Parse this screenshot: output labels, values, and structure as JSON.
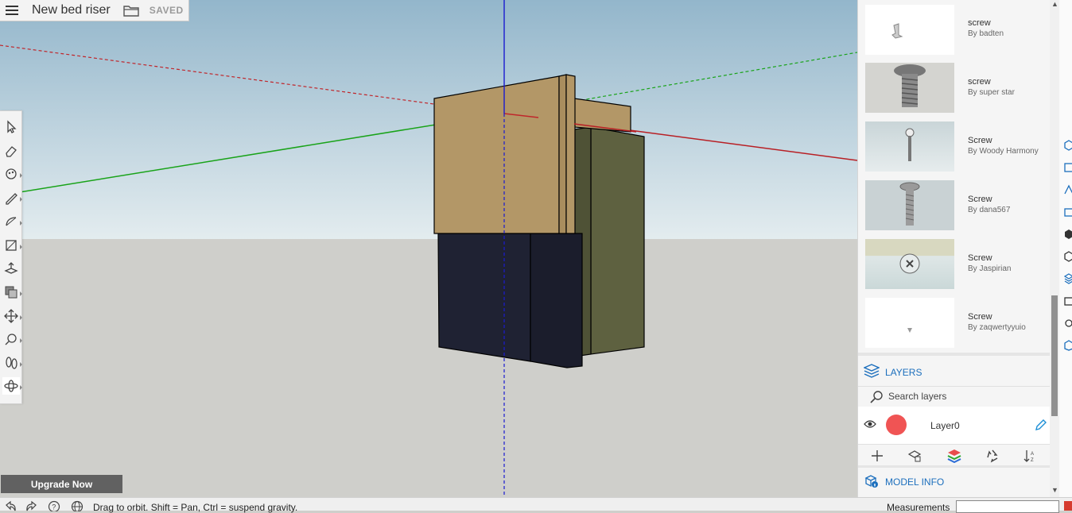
{
  "header": {
    "model_title": "New bed riser",
    "save_status": "SAVED"
  },
  "toolbar": {
    "tools": [
      {
        "name": "select-tool-icon"
      },
      {
        "name": "eraser-tool-icon"
      },
      {
        "name": "paint-bucket-tool-icon"
      },
      {
        "name": "pencil-line-tool-icon"
      },
      {
        "name": "arc-tool-icon"
      },
      {
        "name": "rectangle-tool-icon"
      },
      {
        "name": "push-pull-tool-icon"
      },
      {
        "name": "offset-tool-icon"
      },
      {
        "name": "move-tool-icon"
      },
      {
        "name": "tape-measure-tool-icon"
      },
      {
        "name": "walk-tool-icon"
      },
      {
        "name": "orbit-tool-icon"
      }
    ]
  },
  "upgrade": {
    "label": "Upgrade Now"
  },
  "statusbar": {
    "hint": "Drag to orbit. Shift = Pan, Ctrl = suspend gravity.",
    "measurements_label": "Measurements",
    "measurements_value": ""
  },
  "components": {
    "items": [
      {
        "name": "screw",
        "author": "By badten"
      },
      {
        "name": "screw",
        "author": "By super star"
      },
      {
        "name": "Screw",
        "author": "By Woody Harmony"
      },
      {
        "name": "Screw",
        "author": "By dana567"
      },
      {
        "name": "Screw",
        "author": "By Jaspirian"
      },
      {
        "name": "Screw",
        "author": "By zaqwertyyuio"
      }
    ]
  },
  "layers": {
    "title": "LAYERS",
    "search_placeholder": "Search layers",
    "items": [
      {
        "name": "Layer0",
        "color": "#f05454",
        "visible": true
      }
    ]
  },
  "model_info": {
    "title": "MODEL INFO"
  },
  "colors": {
    "accent": "#1c6fbd",
    "sky_top": "#9dbdd0",
    "ground": "#cfcfcb",
    "wood": "#b39767",
    "dark_block": "#1f2233",
    "olive_block": "#5e6140"
  }
}
